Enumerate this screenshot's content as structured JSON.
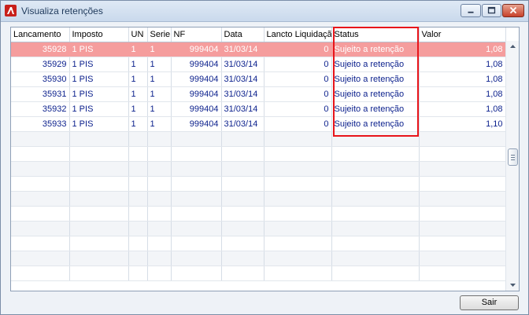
{
  "window": {
    "title": "Visualiza retenções"
  },
  "grid": {
    "columns": [
      "Lancamento",
      "Imposto",
      "UN",
      "Serie",
      "NF",
      "Data",
      "Lancto Liquidação",
      "Status",
      "Valor"
    ],
    "rows": [
      [
        "35928",
        "1 PIS",
        "1",
        "1",
        "999404",
        "31/03/14",
        "0",
        "Sujeito a retenção",
        "1,08"
      ],
      [
        "35929",
        "1 PIS",
        "1",
        "1",
        "999404",
        "31/03/14",
        "0",
        "Sujeito a retenção",
        "1,08"
      ],
      [
        "35930",
        "1 PIS",
        "1",
        "1",
        "999404",
        "31/03/14",
        "0",
        "Sujeito a retenção",
        "1,08"
      ],
      [
        "35931",
        "1 PIS",
        "1",
        "1",
        "999404",
        "31/03/14",
        "0",
        "Sujeito a retenção",
        "1,08"
      ],
      [
        "35932",
        "1 PIS",
        "1",
        "1",
        "999404",
        "31/03/14",
        "0",
        "Sujeito a retenção",
        "1,08"
      ],
      [
        "35933",
        "1 PIS",
        "1",
        "1",
        "999404",
        "31/03/14",
        "0",
        "Sujeito a retenção",
        "1,10"
      ]
    ],
    "selected_row": 0,
    "highlighted_column": "Status"
  },
  "buttons": {
    "exit_label": "Sair"
  },
  "icons": {
    "app": "app-logo-icon",
    "minimize": "minimize-icon",
    "maximize": "maximize-icon",
    "close": "close-icon"
  },
  "colors": {
    "selected_row": "#f59d9d",
    "cell_text": "#0a1f8c",
    "highlight_box": "#e8141a"
  }
}
